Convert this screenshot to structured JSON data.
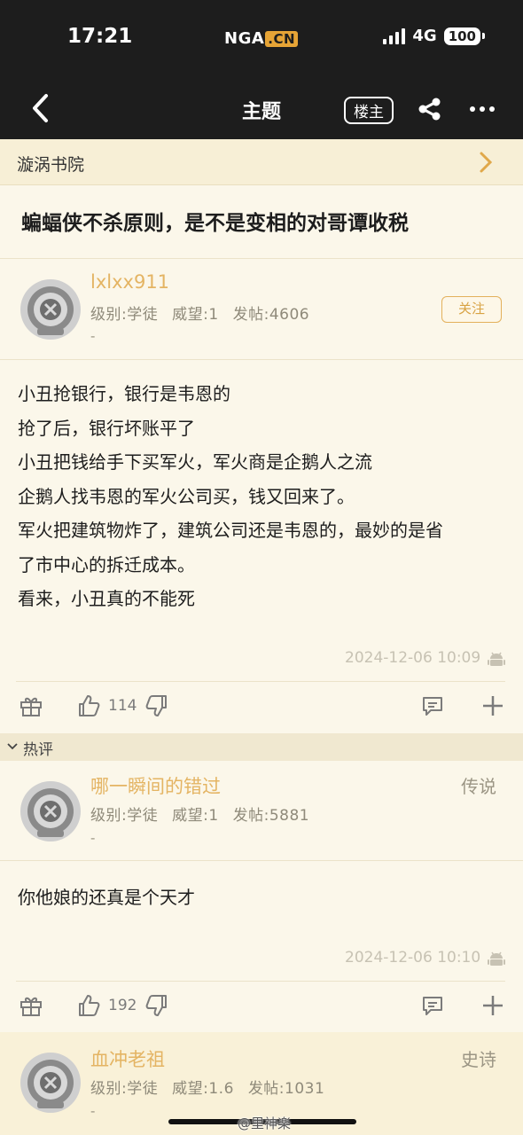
{
  "status": {
    "time": "17:21",
    "logo": "NGA",
    "logo_suffix": ".CN",
    "network": "4G",
    "battery": "100"
  },
  "nav": {
    "title": "主题",
    "op_label": "楼主",
    "icons": [
      "back-chevron-icon",
      "share-icon",
      "more-icon"
    ]
  },
  "forum": {
    "name": "漩涡书院"
  },
  "topic": {
    "title": "蝙蝠侠不杀原则，是不是变相的对哥谭收税"
  },
  "posts": [
    {
      "username": "lxlxx911",
      "level": "级别:学徒",
      "prestige": "威望:1",
      "post_count": "发帖:4606",
      "signature": "-",
      "follow_label": "关注",
      "content": [
        "小丑抢银行，银行是韦恩的",
        "抢了后，银行坏账平了",
        "小丑把钱给手下买军火，军火商是企鹅人之流",
        "企鹅人找韦恩的军火公司买，钱又回来了。",
        "军火把建筑物炸了，建筑公司还是韦恩的，最妙的是省",
        "了市中心的拆迁成本。",
        "看来，小丑真的不能死"
      ],
      "time": "2024-12-06 10:09",
      "likes": "114"
    }
  ],
  "hot_section": {
    "label": "热评"
  },
  "hot_replies": [
    {
      "username": "哪一瞬间的错过",
      "rank": "传说",
      "level": "级别:学徒",
      "prestige": "威望:1",
      "post_count": "发帖:5881",
      "signature": "-",
      "content": "你他娘的还真是个天才",
      "time": "2024-12-06 10:10",
      "likes": "192"
    },
    {
      "username": "血冲老祖",
      "rank": "史诗",
      "level": "级别:学徒",
      "prestige": "威望:1.6",
      "post_count": "发帖:1031",
      "signature": "-"
    }
  ],
  "watermark": "@里神楽",
  "colors": {
    "accent": "#e4b463",
    "topbar": "#1d1d1d",
    "background": "#fbf7ea"
  }
}
